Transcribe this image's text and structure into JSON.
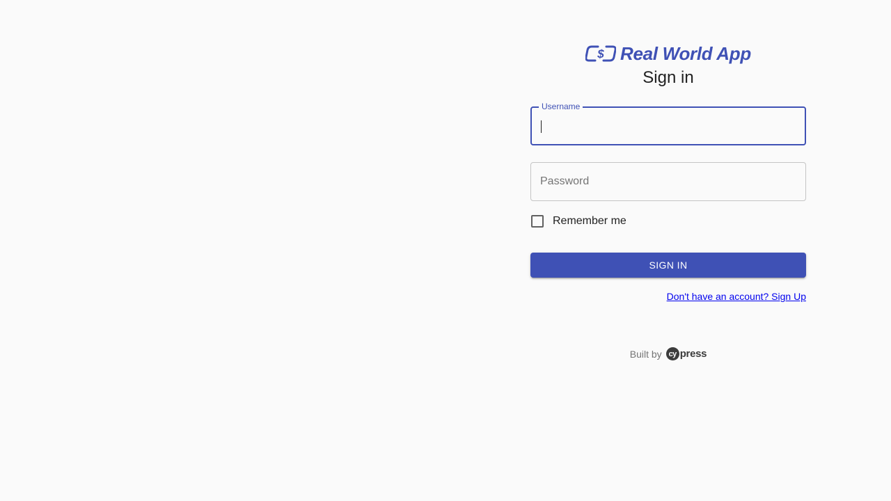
{
  "brand": {
    "name": "Real World App",
    "icon": "dollar-exchange-icon",
    "color": "#3f51b5"
  },
  "form": {
    "title": "Sign in",
    "username": {
      "label": "Username",
      "value": ""
    },
    "password": {
      "placeholder": "Password",
      "value": ""
    },
    "remember_me": {
      "label": "Remember me",
      "checked": false
    },
    "submit_label": "SIGN IN",
    "signup_link": "Don't have an account? Sign Up"
  },
  "footer": {
    "built_by": "Built by",
    "logo_text_badge": "cy",
    "logo_text_rest": "press"
  }
}
